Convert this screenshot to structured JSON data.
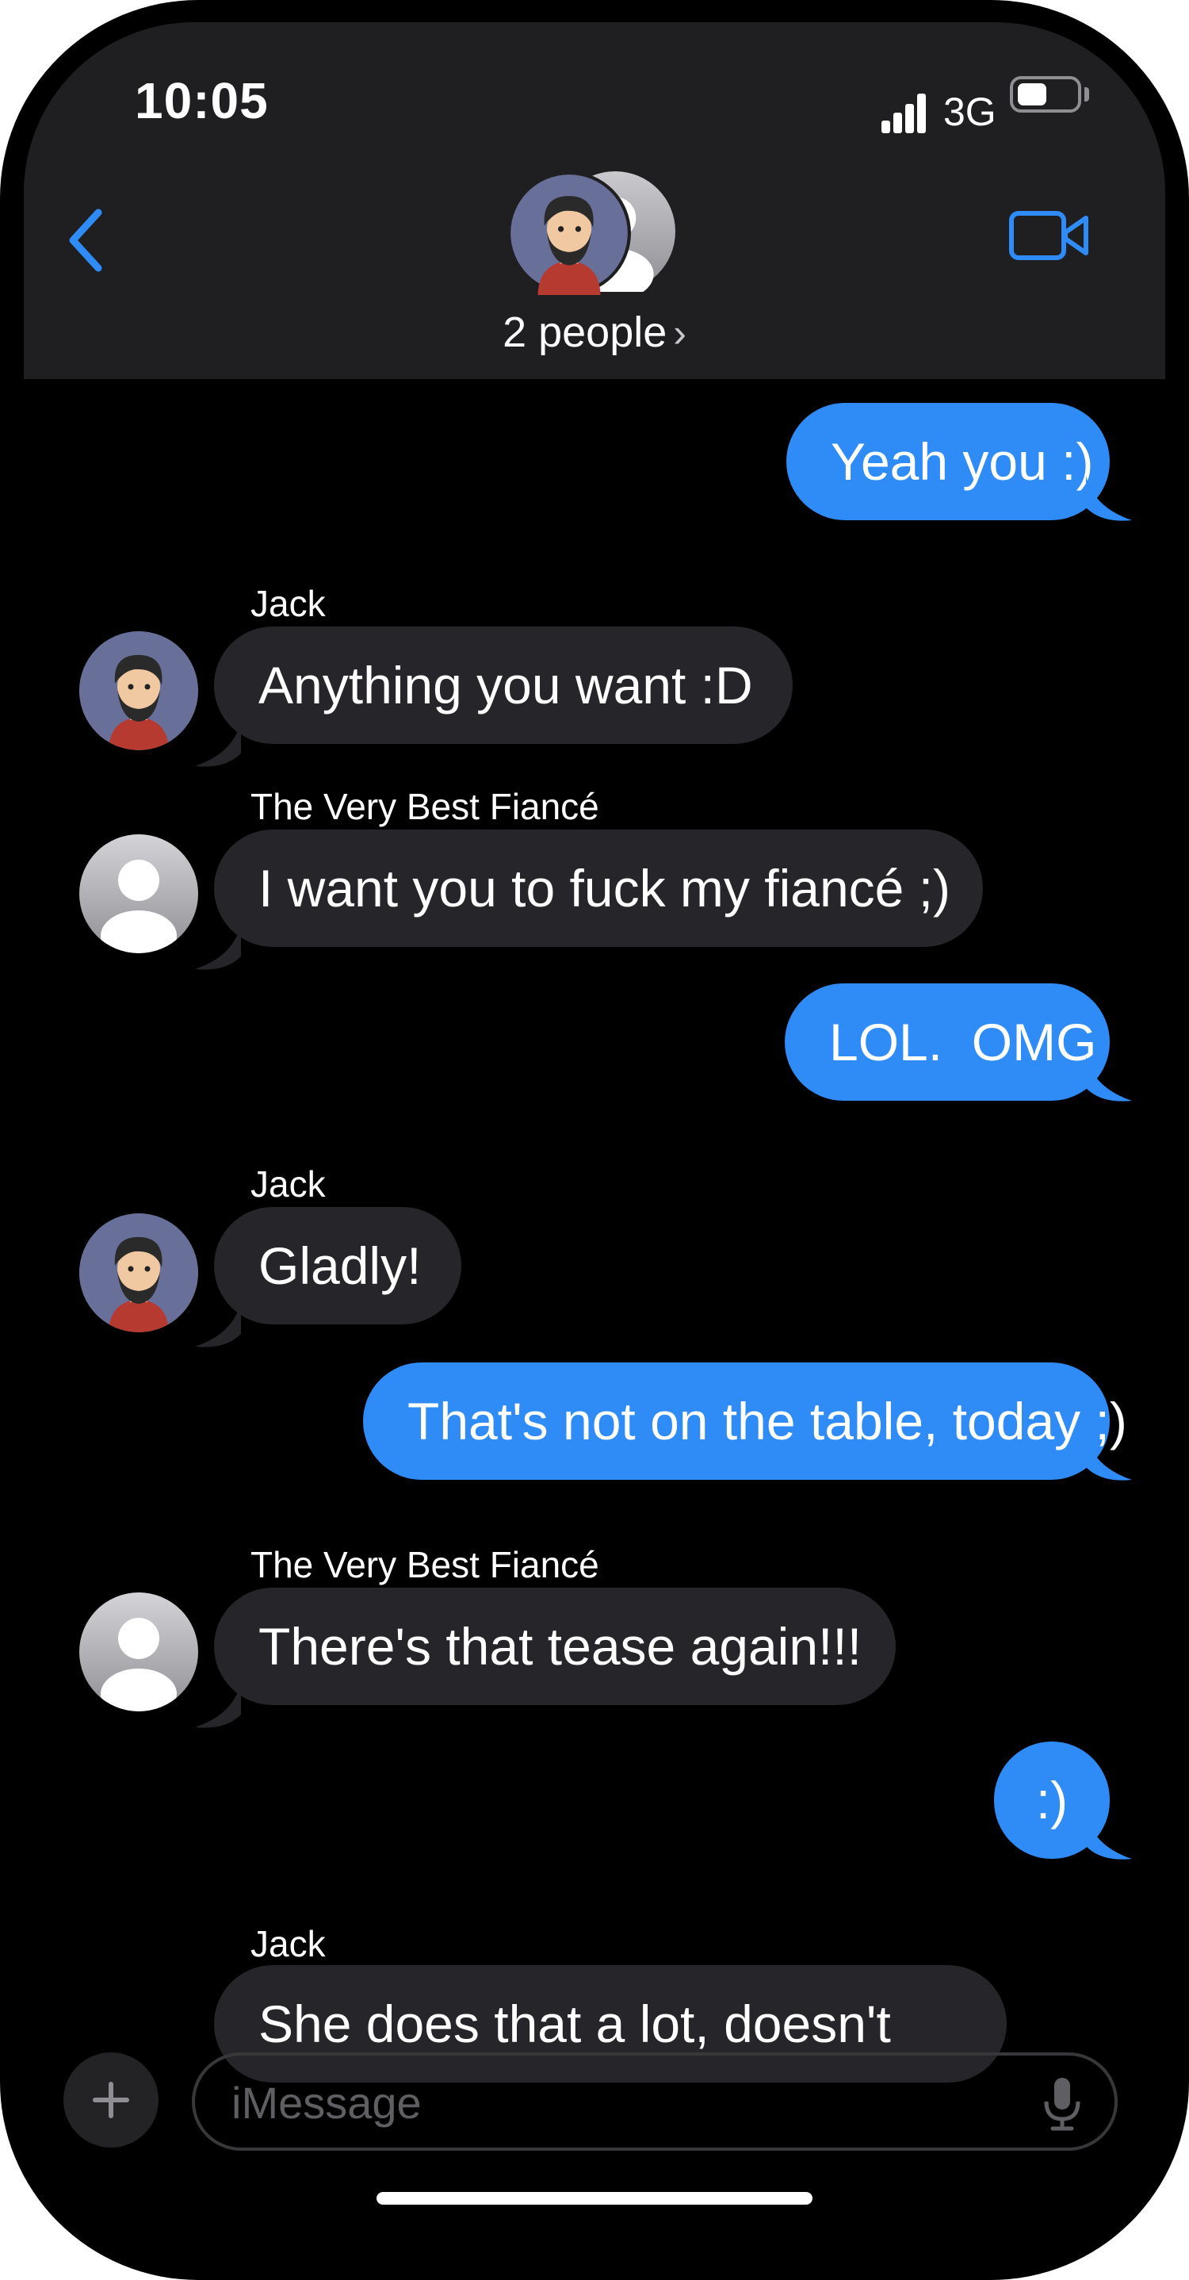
{
  "status_bar": {
    "time": "10:05",
    "network": "3G"
  },
  "header": {
    "title": "2 people",
    "chevron": "›",
    "back_icon": "chevron-left-icon",
    "video_icon": "video-camera-icon"
  },
  "colors": {
    "accent": "#2f8cf7",
    "incoming_bubble": "#26252a",
    "header_bg": "#1f1f21",
    "background": "#000000"
  },
  "messages": [
    {
      "direction": "out",
      "text": "Yeah you :)"
    },
    {
      "direction": "in",
      "sender": "Jack",
      "avatar": "jack-avatar",
      "text": "Anything you want :D"
    },
    {
      "direction": "in",
      "sender": "The Very Best Fiancé",
      "avatar": "generic-contact-avatar",
      "text": "I want you to fuck my fiancé ;)"
    },
    {
      "direction": "out",
      "text": "LOL.  OMG"
    },
    {
      "direction": "in",
      "sender": "Jack",
      "avatar": "jack-avatar",
      "text": "Gladly!"
    },
    {
      "direction": "out",
      "text": "That's not on the table, today ;)"
    },
    {
      "direction": "in",
      "sender": "The Very Best Fiancé",
      "avatar": "generic-contact-avatar",
      "text": "There's that tease again!!!"
    },
    {
      "direction": "out",
      "text": ":)"
    },
    {
      "direction": "in",
      "sender": "Jack",
      "avatar": "jack-avatar",
      "text": "She does that a lot, doesn't"
    }
  ],
  "composer": {
    "placeholder": "iMessage",
    "plus_icon": "plus-icon",
    "mic_icon": "microphone-icon"
  }
}
